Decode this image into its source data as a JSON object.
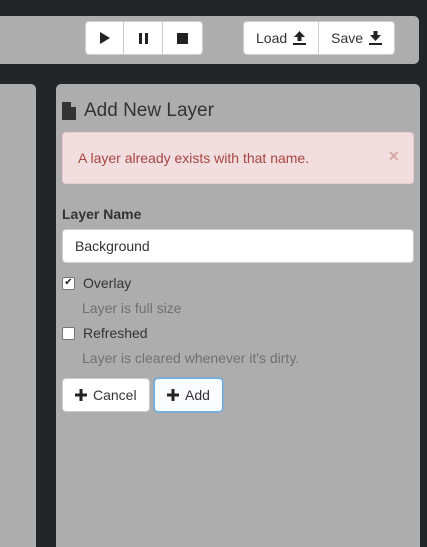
{
  "toolbar": {
    "transport": [
      {
        "icon": "play-icon"
      },
      {
        "icon": "pause-icon"
      },
      {
        "icon": "stop-icon"
      }
    ],
    "load_label": "Load",
    "save_label": "Save"
  },
  "panel": {
    "title": "Add New Layer",
    "alert": {
      "message": "A layer already exists with that name.",
      "close": "×"
    },
    "layer_name_label": "Layer Name",
    "layer_name_value": "Background",
    "overlay": {
      "label": "Overlay",
      "checked": true,
      "help": "Layer is full size"
    },
    "refreshed": {
      "label": "Refreshed",
      "checked": false,
      "help": "Layer is cleared whenever it's dirty."
    },
    "cancel_label": "Cancel",
    "add_label": "Add"
  },
  "colors": {
    "background": "#232628",
    "panel": "#adadad",
    "alert_bg": "#f2dede",
    "alert_text": "#a94442",
    "focus": "#66afe9"
  }
}
